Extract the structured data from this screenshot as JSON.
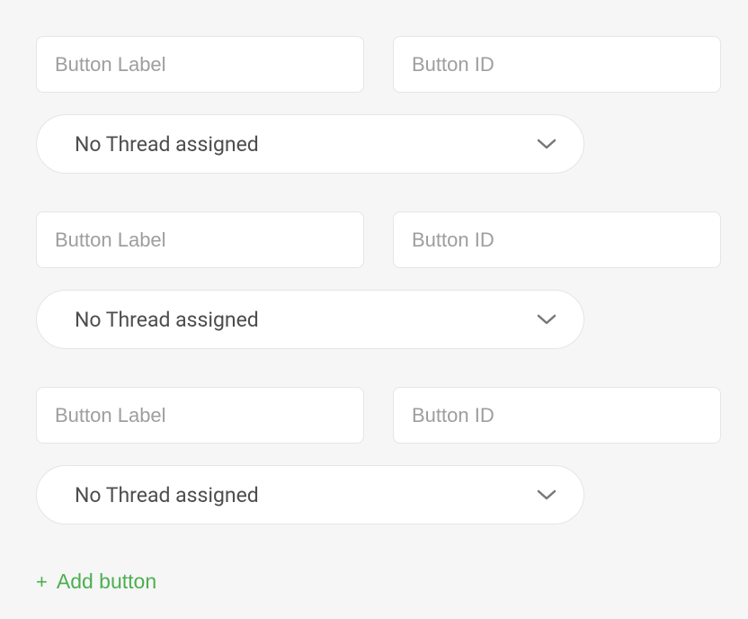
{
  "buttons": [
    {
      "label_placeholder": "Button Label",
      "id_placeholder": "Button ID",
      "thread_selected": "No Thread assigned"
    },
    {
      "label_placeholder": "Button Label",
      "id_placeholder": "Button ID",
      "thread_selected": "No Thread assigned"
    },
    {
      "label_placeholder": "Button Label",
      "id_placeholder": "Button ID",
      "thread_selected": "No Thread assigned"
    }
  ],
  "add_button_label": "Add button"
}
